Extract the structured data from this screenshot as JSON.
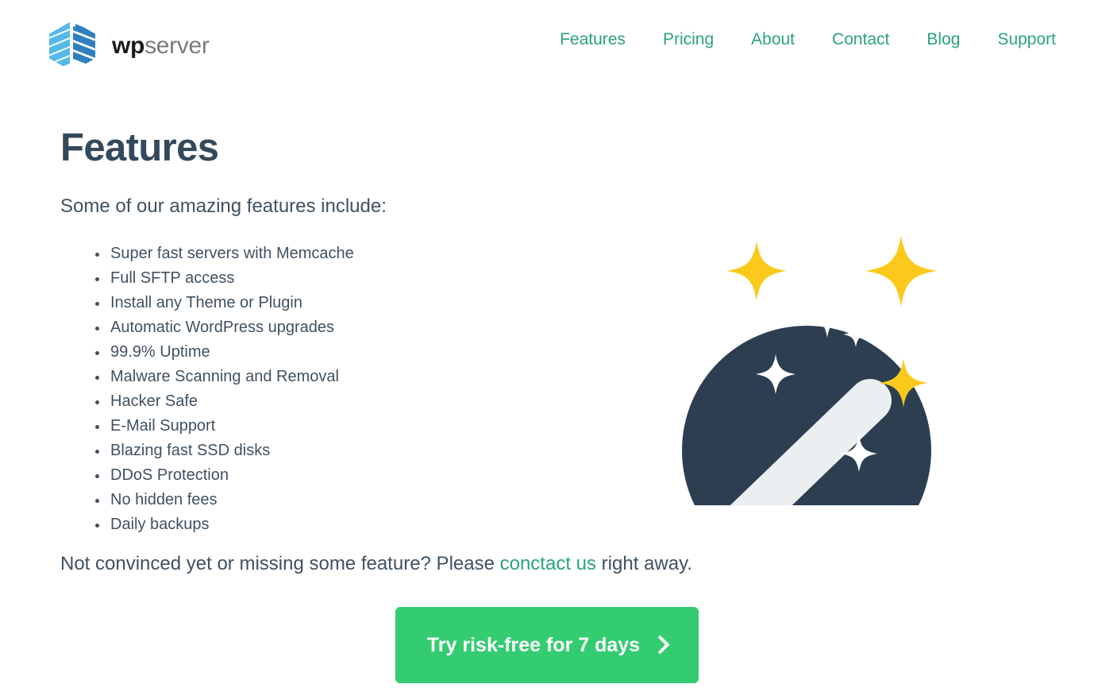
{
  "brand": {
    "name_bold": "wp",
    "name_light": "server",
    "logo_icon": "hexagon-stripes-logo",
    "logo_colors": [
      "#4cb3e4",
      "#2f7fc1",
      "#7ec9ef"
    ]
  },
  "nav": {
    "items": [
      {
        "label": "Features"
      },
      {
        "label": "Pricing"
      },
      {
        "label": "About"
      },
      {
        "label": "Contact"
      },
      {
        "label": "Blog"
      },
      {
        "label": "Support"
      }
    ],
    "link_color": "#2aa37b"
  },
  "main": {
    "title": "Features",
    "lede": "Some of our amazing features include:",
    "features": [
      "Super fast servers with Memcache",
      "Full SFTP access",
      "Install any Theme or Plugin",
      "Automatic WordPress upgrades",
      "99.9% Uptime",
      "Malware Scanning and Removal",
      "Hacker Safe",
      "E-Mail Support",
      "Blazing fast SSD disks",
      "DDoS Protection",
      "No hidden fees",
      "Daily backups"
    ],
    "closing": {
      "before_link": "Not convinced yet or missing some feature? Please ",
      "link_text": "conctact us",
      "after_link": " right away."
    },
    "cta": {
      "label": "Try risk-free for 7 days",
      "icon": "chevron-right-icon",
      "background": "#33cc71",
      "text_color": "#ffffff"
    },
    "illustration": {
      "name": "magic-wand-illustration",
      "circle_color": "#2c3e50",
      "wand_color": "#eceff1",
      "sparkle_white": "#ffffff",
      "sparkle_yellow": "#fbc91b"
    }
  },
  "theme": {
    "background": "#ffffff",
    "heading_color": "#35495c",
    "body_text_color": "#3f5162",
    "accent_green": "#2aa37b",
    "cta_green": "#33cc71",
    "navy": "#2c3e50",
    "yellow": "#fbc91b"
  }
}
